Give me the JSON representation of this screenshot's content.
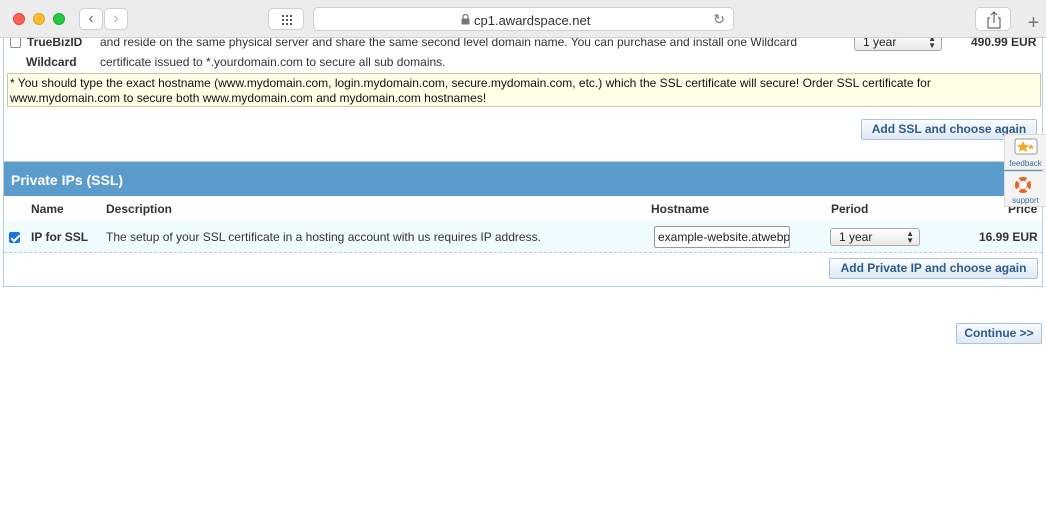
{
  "browser": {
    "url": "cp1.awardspace.net"
  },
  "top_product": {
    "name_line1": "TrueBizID",
    "name_line2": "Wildcard",
    "desc_line1": "and reside on the same physical server and share the same second level domain name. You can purchase and install one Wildcard",
    "desc_line2": "certificate issued to *.yourdomain.com to secure all sub domains.",
    "period": "1 year",
    "price": "490.99 EUR"
  },
  "note": {
    "line1": "* You should type the exact hostname (www.mydomain.com, login.mydomain.com, secure.mydomain.com, etc.) which the SSL certificate will secure! Order SSL certificate for",
    "line2": "www.mydomain.com to secure both www.mydomain.com and mydomain.com hostnames!"
  },
  "add_ssl_button": "Add SSL and choose again",
  "private_ips": {
    "title": "Private IPs (SSL)",
    "columns": {
      "name": "Name",
      "description": "Description",
      "hostname": "Hostname",
      "period": "Period",
      "price": "Price"
    },
    "row": {
      "name": "IP for SSL",
      "description": "The setup of your SSL certificate in a hosting account with us requires IP address.",
      "hostname": "example-website.atwebpages.com",
      "period": "1 year",
      "price": "16.99 EUR",
      "checked": true
    },
    "add_button": "Add Private IP and choose again"
  },
  "continue_button": "Continue >>",
  "side_widgets": {
    "feedback": "feedback",
    "support": "support"
  }
}
